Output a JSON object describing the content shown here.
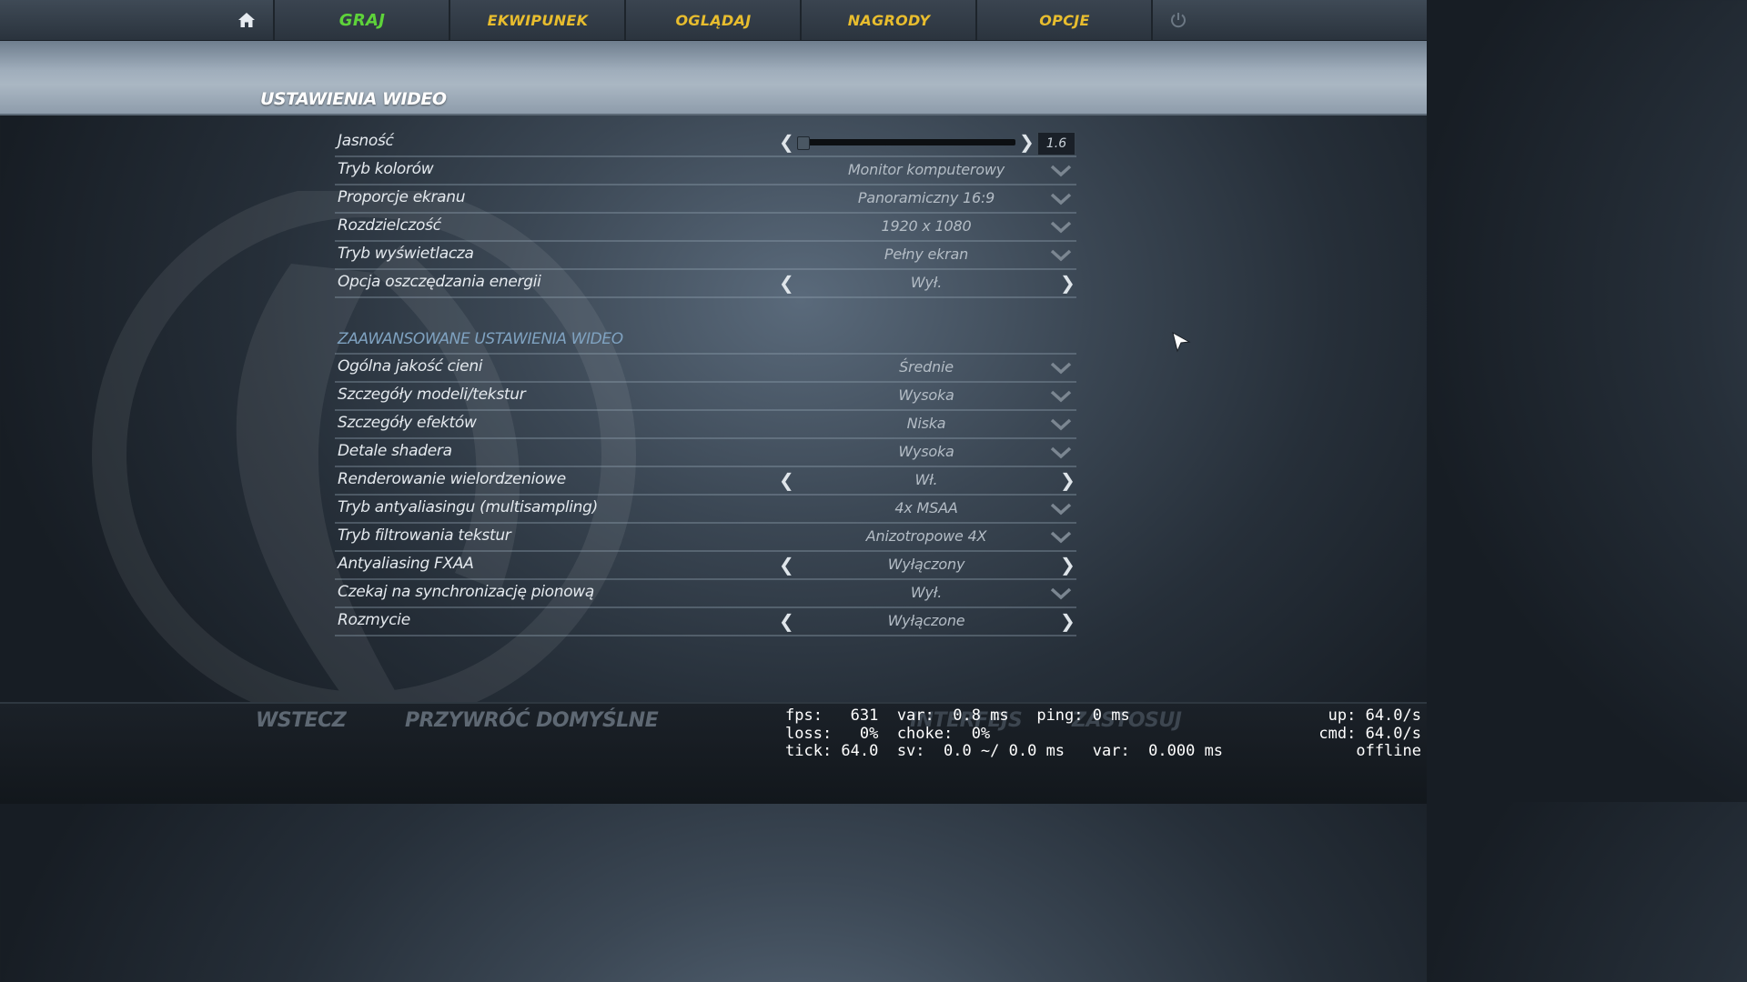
{
  "nav": {
    "tabs": [
      {
        "label": "GRAJ",
        "active": true
      },
      {
        "label": "EKWIPUNEK",
        "active": false
      },
      {
        "label": "OGLĄDAJ",
        "active": false
      },
      {
        "label": "NAGRODY",
        "active": false
      },
      {
        "label": "OPCJE",
        "active": false
      }
    ],
    "home_icon": "home-icon",
    "power_icon": "power-icon"
  },
  "page_title": "USTAWIENIA WIDEO",
  "settings": {
    "brightness": {
      "label": "Jasność",
      "value": "1.6",
      "level_fraction": 0.0
    },
    "color_mode": {
      "label": "Tryb kolorów",
      "value": "Monitor komputerowy"
    },
    "aspect_ratio": {
      "label": "Proporcje ekranu",
      "value": "Panoramiczny 16:9"
    },
    "resolution": {
      "label": "Rozdzielczość",
      "value": "1920 x 1080"
    },
    "display_mode": {
      "label": "Tryb wyświetlacza",
      "value": "Pełny ekran"
    },
    "power_saving": {
      "label": "Opcja oszczędzania energii",
      "value": "Wył."
    }
  },
  "advanced": {
    "heading": "ZAAWANSOWANE USTAWIENIA WIDEO",
    "shadow_quality": {
      "label": "Ogólna jakość cieni",
      "value": "Średnie"
    },
    "model_texture": {
      "label": "Szczegóły modeli/tekstur",
      "value": "Wysoka"
    },
    "effect_detail": {
      "label": "Szczegóły efektów",
      "value": "Niska"
    },
    "shader_detail": {
      "label": "Detale shadera",
      "value": "Wysoka"
    },
    "multicore": {
      "label": "Renderowanie wielordzeniowe",
      "value": "Wł."
    },
    "msaa": {
      "label": "Tryb antyaliasingu (multisampling)",
      "value": "4x MSAA"
    },
    "texture_filter": {
      "label": "Tryb filtrowania tekstur",
      "value": "Anizotropowe 4X"
    },
    "fxaa": {
      "label": "Antyaliasing FXAA",
      "value": "Wyłączony"
    },
    "vsync": {
      "label": "Czekaj na synchronizację pionową",
      "value": "Wył."
    },
    "motion_blur": {
      "label": "Rozmycie",
      "value": "Wyłączone"
    }
  },
  "bottom": {
    "back": "WSTECZ",
    "restore_defaults": "PRZYWRÓĆ DOMYŚLNE",
    "interface": "INTERFEJS",
    "apply": "ZASTOSUJ"
  },
  "netgraph": {
    "line1": "fps:   631  var:  0.8 ms   ping: 0 ms",
    "line2": "loss:   0%  choke:  0%",
    "line3": "tick: 64.0  sv:  0.0 ~/ 0.0 ms   var:  0.000 ms",
    "right1": "up: 64.0/s",
    "right2": "cmd: 64.0/s",
    "right3": "offline"
  }
}
